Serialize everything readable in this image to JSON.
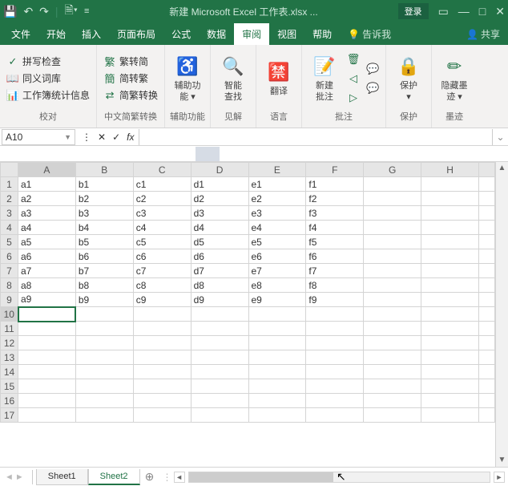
{
  "title": "新建 Microsoft Excel 工作表.xlsx  ...",
  "login": "登录",
  "tabs": [
    "文件",
    "开始",
    "插入",
    "页面布局",
    "公式",
    "数据",
    "审阅",
    "视图",
    "帮助"
  ],
  "activeTab": "审阅",
  "tell": "告诉我",
  "share": "共享",
  "ribbon": {
    "proof": {
      "label": "校对",
      "spell": "拼写检查",
      "thes": "同义词库",
      "stats": "工作簿统计信息"
    },
    "cnconv": {
      "label": "中文简繁转换",
      "t2s": "繁转简",
      "s2t": "简转繁",
      "st": "简繁转换"
    },
    "acc": {
      "label": "辅助功能",
      "btn": "辅助功\n能 ▾"
    },
    "insight": {
      "label": "见解",
      "btn": "智能\n查找"
    },
    "lang": {
      "label": "语言",
      "btn": "翻译"
    },
    "comments": {
      "label": "批注",
      "new": "新建\n批注"
    },
    "protect": {
      "label": "保护",
      "btn": "保护\n▾"
    },
    "ink": {
      "label": "墨迹",
      "btn": "隐藏墨\n迹 ▾"
    }
  },
  "nameBox": "A10",
  "columns": [
    "A",
    "B",
    "C",
    "D",
    "E",
    "F",
    "G",
    "H"
  ],
  "rows": [
    1,
    2,
    3,
    4,
    5,
    6,
    7,
    8,
    9,
    10,
    11,
    12,
    13,
    14,
    15,
    16,
    17
  ],
  "activeRow": 10,
  "activeCol": "A",
  "cells": [
    [
      "a1",
      "b1",
      "c1",
      "d1",
      "e1",
      "f1",
      "",
      ""
    ],
    [
      "a2",
      "b2",
      "c2",
      "d2",
      "e2",
      "f2",
      "",
      ""
    ],
    [
      "a3",
      "b3",
      "c3",
      "d3",
      "e3",
      "f3",
      "",
      ""
    ],
    [
      "a4",
      "b4",
      "c4",
      "d4",
      "e4",
      "f4",
      "",
      ""
    ],
    [
      "a5",
      "b5",
      "c5",
      "d5",
      "e5",
      "f5",
      "",
      ""
    ],
    [
      "a6",
      "b6",
      "c6",
      "d6",
      "e6",
      "f6",
      "",
      ""
    ],
    [
      "a7",
      "b7",
      "c7",
      "d7",
      "e7",
      "f7",
      "",
      ""
    ],
    [
      "a8",
      "b8",
      "c8",
      "d8",
      "e8",
      "f8",
      "",
      ""
    ],
    [
      "a9",
      "b9",
      "c9",
      "d9",
      "e9",
      "f9",
      "",
      ""
    ],
    [
      "",
      "",
      "",
      "",
      "",
      "",
      "",
      ""
    ],
    [
      "",
      "",
      "",
      "",
      "",
      "",
      "",
      ""
    ],
    [
      "",
      "",
      "",
      "",
      "",
      "",
      "",
      ""
    ],
    [
      "",
      "",
      "",
      "",
      "",
      "",
      "",
      ""
    ],
    [
      "",
      "",
      "",
      "",
      "",
      "",
      "",
      ""
    ],
    [
      "",
      "",
      "",
      "",
      "",
      "",
      "",
      ""
    ],
    [
      "",
      "",
      "",
      "",
      "",
      "",
      "",
      ""
    ],
    [
      "",
      "",
      "",
      "",
      "",
      "",
      "",
      ""
    ]
  ],
  "sheets": [
    "Sheet1",
    "Sheet2"
  ],
  "activeSheet": "Sheet2"
}
